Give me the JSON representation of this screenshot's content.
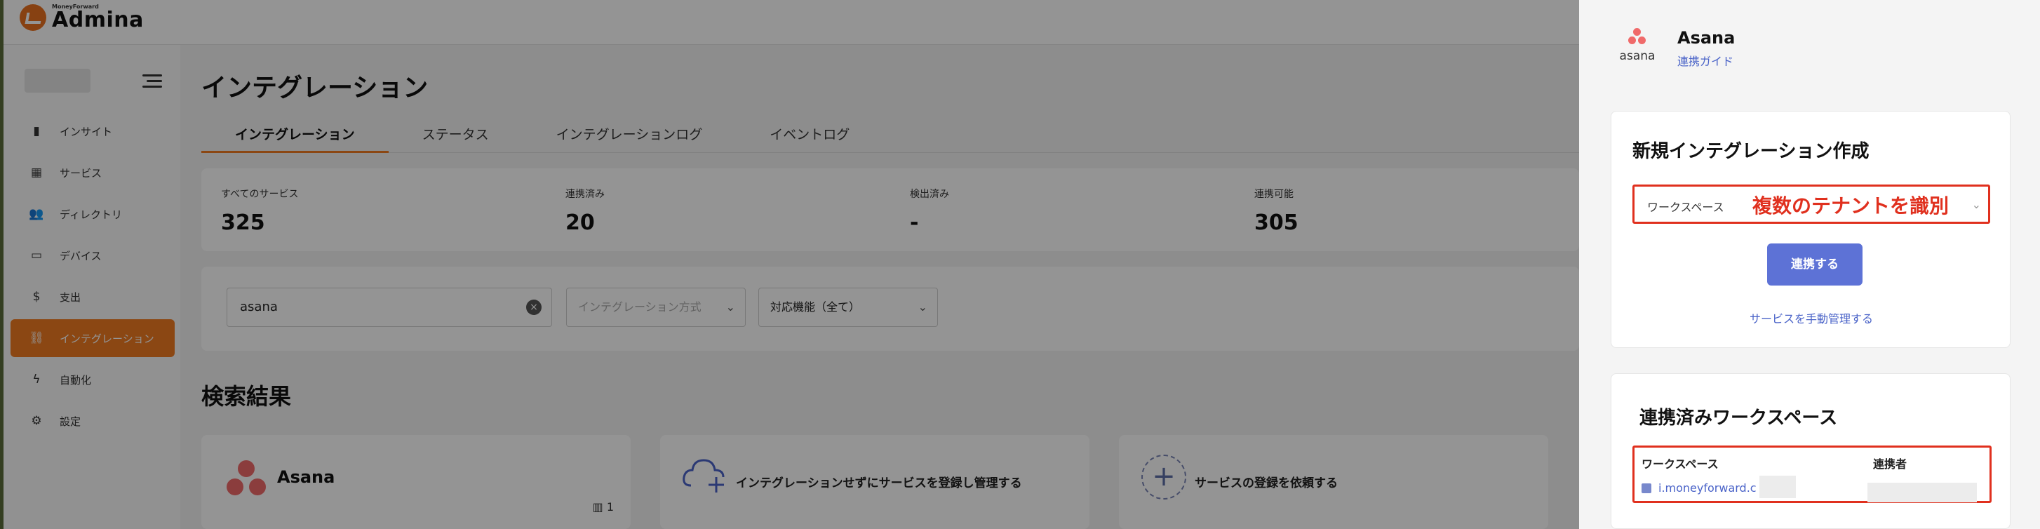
{
  "app": {
    "logo_small": "MoneyForward",
    "logo_name": "Admina"
  },
  "sidebar": {
    "items": [
      {
        "label": "インサイト",
        "icon": "bar-chart-icon",
        "glyph": "▮"
      },
      {
        "label": "サービス",
        "icon": "grid-icon",
        "glyph": "▦"
      },
      {
        "label": "ディレクトリ",
        "icon": "people-icon",
        "glyph": "👥"
      },
      {
        "label": "デバイス",
        "icon": "laptop-icon",
        "glyph": "▭"
      },
      {
        "label": "支出",
        "icon": "dollar-icon",
        "glyph": "$"
      },
      {
        "label": "インテグレーション",
        "icon": "link-icon",
        "glyph": "⛓",
        "active": true
      },
      {
        "label": "自動化",
        "icon": "bolt-icon",
        "glyph": "ϟ"
      },
      {
        "label": "設定",
        "icon": "gear-icon",
        "glyph": "⚙"
      }
    ]
  },
  "main": {
    "title": "インテグレーション",
    "tabs": [
      "インテグレーション",
      "ステータス",
      "インテグレーションログ",
      "イベントログ"
    ],
    "stats": [
      {
        "label": "すべてのサービス",
        "value": "325"
      },
      {
        "label": "連携済み",
        "value": "20"
      },
      {
        "label": "検出済み",
        "value": "-"
      },
      {
        "label": "連携可能",
        "value": "305"
      }
    ],
    "search_value": "asana",
    "filter_method": "インテグレーション方式",
    "filter_function": "対応機能（全て）",
    "results_title": "検索結果",
    "cards": {
      "asana_name": "Asana",
      "asana_count": "1",
      "register_text": "インテグレーションせずにサービスを登録し管理する",
      "request_text": "サービスの登録を依頼する"
    }
  },
  "panel": {
    "service_name": "Asana",
    "logo_word": "asana",
    "guide_link": "連携ガイド",
    "create_title": "新規インテグレーション作成",
    "workspace_label": "ワークスペース",
    "annotation": "複数のテナントを識別",
    "connect_button": "連携する",
    "manual_link": "サービスを手動管理する",
    "connected_title": "連携済みワークスペース",
    "table_headers": [
      "ワークスペース",
      "連携者"
    ],
    "workspace_row": "i.moneyforward.c"
  },
  "colors": {
    "accent": "#ef7b22",
    "link": "#4a63c8",
    "button": "#5d72d6",
    "annotation_red": "#e0301e",
    "asana_pink": "#f06a6a"
  }
}
